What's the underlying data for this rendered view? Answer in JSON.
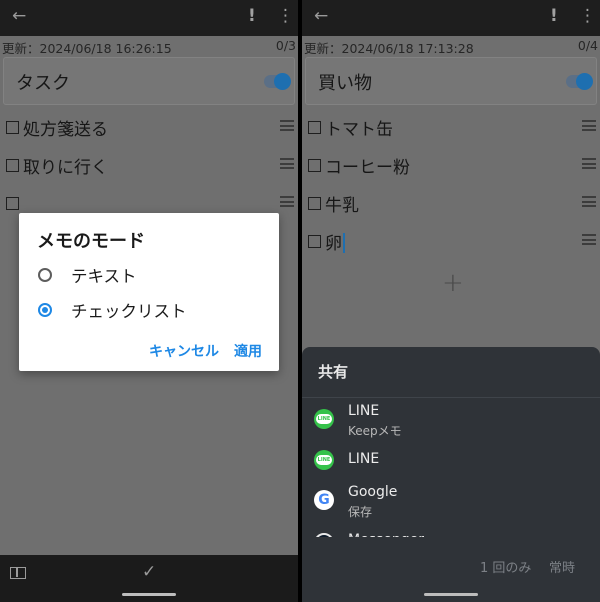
{
  "icons": {
    "back": "←",
    "alert": "!",
    "more": "⋮",
    "check": "✓",
    "plus": "+"
  },
  "left": {
    "updated": "更新：2024/06/18 16:26:15",
    "counter": "0/3",
    "title": "タスク",
    "items": [
      "処方箋送る",
      "取りに行く",
      ""
    ],
    "dialog": {
      "title": "メモのモード",
      "options": [
        "テキスト",
        "チェックリスト"
      ],
      "selected_index": 1,
      "cancel": "キャンセル",
      "apply": "適用"
    }
  },
  "right": {
    "updated": "更新：2024/06/18 17:13:28",
    "counter": "0/4",
    "title": "買い物",
    "items": [
      "トマト缶",
      "コーヒー粉",
      "牛乳",
      "卵"
    ],
    "share": {
      "title": "共有",
      "apps": [
        {
          "name": "LINE",
          "sub": "Keepメモ",
          "icon": "line-icon"
        },
        {
          "name": "LINE",
          "sub": "",
          "icon": "line-icon"
        },
        {
          "name": "Google",
          "sub": "保存",
          "icon": "google-icon"
        },
        {
          "name": "Messenger",
          "sub": "",
          "icon": "messenger-icon"
        }
      ],
      "just_once": "1 回のみ",
      "always": "常時"
    }
  },
  "colors": {
    "accent": "#1e88e5",
    "line_green": "#35c24a",
    "sheet_bg": "#2f3338"
  }
}
